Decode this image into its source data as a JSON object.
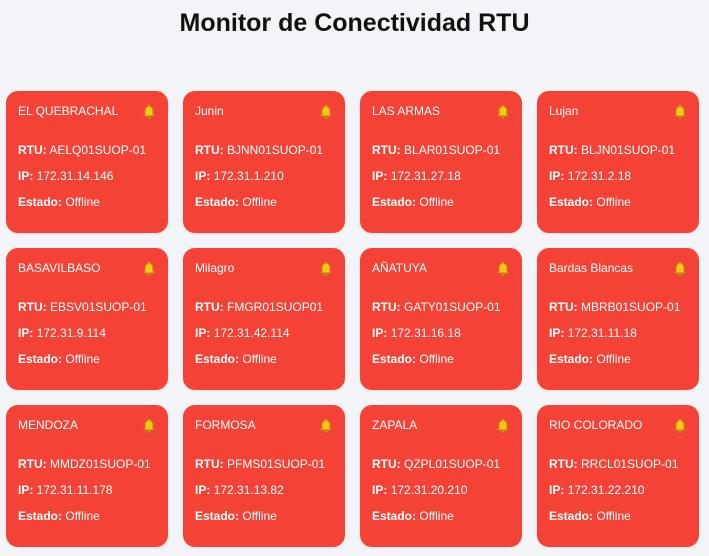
{
  "title": "Monitor de Conectividad RTU",
  "labels": {
    "rtu": "RTU:",
    "ip": "IP:",
    "estado": "Estado:"
  },
  "colors": {
    "offline": "#f44336",
    "background": "#f3f4f8",
    "bell": "#f5c518"
  },
  "icon": "bell-icon",
  "cards": [
    {
      "name": "EL QUEBRACHAL",
      "rtu": "AELQ01SUOP-01",
      "ip": "172.31.14.146",
      "estado": "Offline"
    },
    {
      "name": "Junin",
      "rtu": "BJNN01SUOP-01",
      "ip": "172.31.1.210",
      "estado": "Offline"
    },
    {
      "name": "LAS ARMAS",
      "rtu": "BLAR01SUOP-01",
      "ip": "172.31.27.18",
      "estado": "Offline"
    },
    {
      "name": "Lujan",
      "rtu": "BLJN01SUOP-01",
      "ip": "172.31.2.18",
      "estado": "Offline"
    },
    {
      "name": "BASAVILBASO",
      "rtu": "EBSV01SUOP-01",
      "ip": "172.31.9.114",
      "estado": "Offline"
    },
    {
      "name": "Milagro",
      "rtu": "FMGR01SUOP01",
      "ip": "172.31.42.114",
      "estado": "Offline"
    },
    {
      "name": "AÑATUYA",
      "rtu": "GATY01SUOP-01",
      "ip": "172.31.16.18",
      "estado": "Offline"
    },
    {
      "name": "Bardas Blancas",
      "rtu": "MBRB01SUOP-01",
      "ip": "172.31.11.18",
      "estado": "Offline"
    },
    {
      "name": "MENDOZA",
      "rtu": "MMDZ01SUOP-01",
      "ip": "172.31.11.178",
      "estado": "Offline"
    },
    {
      "name": "FORMOSA",
      "rtu": "PFMS01SUOP-01",
      "ip": "172.31.13.82",
      "estado": "Offline"
    },
    {
      "name": "ZAPALA",
      "rtu": "QZPL01SUOP-01",
      "ip": "172.31.20.210",
      "estado": "Offline"
    },
    {
      "name": "RIO COLORADO",
      "rtu": "RRCL01SUOP-01",
      "ip": "172.31.22.210",
      "estado": "Offline"
    }
  ]
}
